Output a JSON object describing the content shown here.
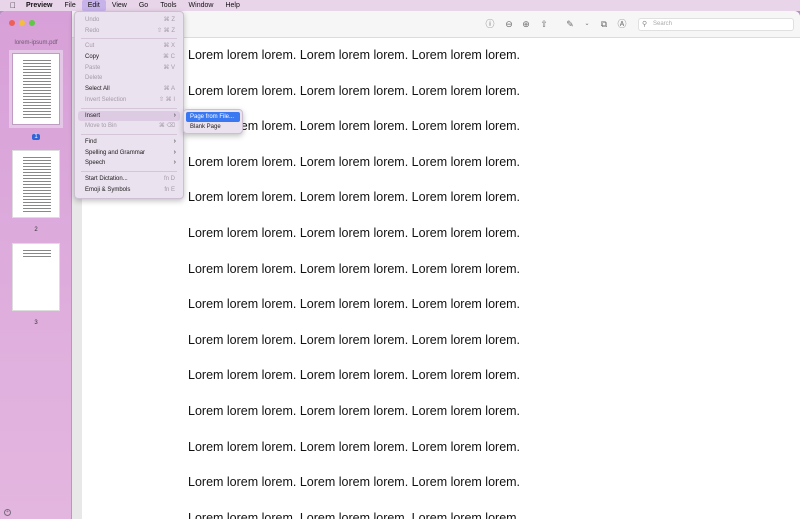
{
  "menubar": {
    "apple": "",
    "items": [
      "Preview",
      "File",
      "Edit",
      "View",
      "Go",
      "Tools",
      "Window",
      "Help"
    ]
  },
  "sidebar": {
    "filename": "lorem-ipsum.pdf",
    "pages": [
      "1",
      "2",
      "3"
    ]
  },
  "toolbar": {
    "search_placeholder": "Search"
  },
  "document": {
    "lines": [
      "Lorem lorem lorem. Lorem lorem lorem. Lorem lorem lorem.",
      "Lorem lorem lorem. Lorem lorem lorem. Lorem lorem lorem.",
      "Lorem lorem lorem. Lorem lorem lorem. Lorem lorem lorem.",
      "Lorem lorem lorem. Lorem lorem lorem. Lorem lorem lorem.",
      "Lorem lorem lorem. Lorem lorem lorem. Lorem lorem lorem.",
      "Lorem lorem lorem. Lorem lorem lorem. Lorem lorem lorem.",
      "Lorem lorem lorem. Lorem lorem lorem. Lorem lorem lorem.",
      "Lorem lorem lorem. Lorem lorem lorem. Lorem lorem lorem.",
      "Lorem lorem lorem. Lorem lorem lorem. Lorem lorem lorem.",
      "Lorem lorem lorem. Lorem lorem lorem. Lorem lorem lorem.",
      "Lorem lorem lorem. Lorem lorem lorem. Lorem lorem lorem.",
      "Lorem lorem lorem. Lorem lorem lorem. Lorem lorem lorem.",
      "Lorem lorem lorem. Lorem lorem lorem. Lorem lorem lorem.",
      "Lorem lorem lorem. Lorem lorem lorem. Lorem lorem lorem."
    ]
  },
  "edit_menu": {
    "undo": "Undo",
    "undo_sc": "⌘ Z",
    "redo": "Redo",
    "redo_sc": "⇧ ⌘ Z",
    "cut": "Cut",
    "cut_sc": "⌘ X",
    "copy": "Copy",
    "copy_sc": "⌘ C",
    "paste": "Paste",
    "paste_sc": "⌘ V",
    "delete": "Delete",
    "select_all": "Select All",
    "select_all_sc": "⌘ A",
    "invert_selection": "Invert Selection",
    "invert_selection_sc": "⇧ ⌘ I",
    "insert": "Insert",
    "move_to_bin": "Move to Bin",
    "move_to_bin_sc": "⌘ ⌫",
    "find": "Find",
    "spelling": "Spelling and Grammar",
    "speech": "Speech",
    "start_dictation": "Start Dictation...",
    "start_dictation_sc": "fn D",
    "emoji": "Emoji & Symbols",
    "emoji_sc": "fn E"
  },
  "insert_submenu": {
    "page_from_file": "Page from File...",
    "blank_page": "Blank Page"
  }
}
